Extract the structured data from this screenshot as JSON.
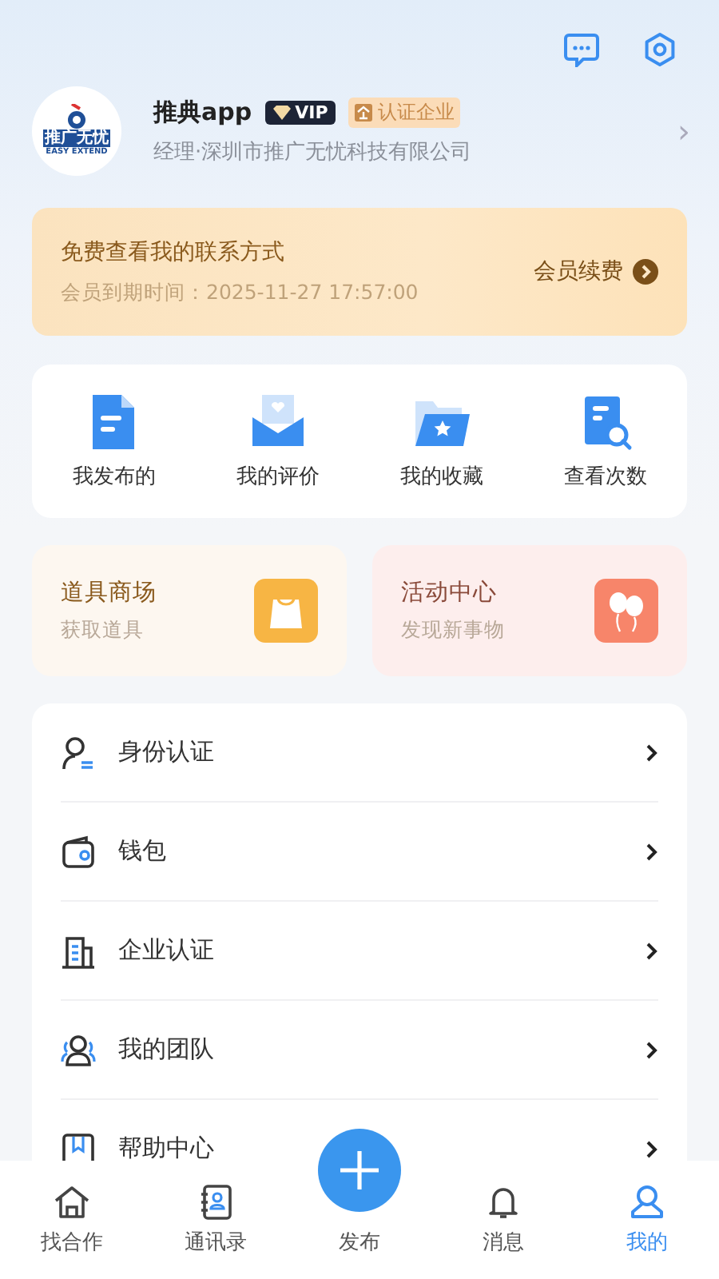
{
  "header": {
    "actions": [
      {
        "kind": "message"
      },
      {
        "kind": "settings"
      }
    ]
  },
  "profile": {
    "logo_text": "推广无忧",
    "logo_subtext": "EASY EXTEND",
    "name": "推典app",
    "vip_badge": "VIP",
    "cert_badge": "认证企业",
    "subtitle": "经理·深圳市推广无忧科技有限公司",
    "chevron": "›"
  },
  "membership": {
    "title": "免费查看我的联系方式",
    "expiry": "会员到期时间：2025-11-27 17:57:00",
    "action": "会员续费"
  },
  "shortcuts": [
    {
      "kind": "publish",
      "label": "我发布的"
    },
    {
      "kind": "review",
      "label": "我的评价"
    },
    {
      "kind": "favorite",
      "label": "我的收藏"
    },
    {
      "kind": "views",
      "label": "查看次数"
    }
  ],
  "promo_cards": [
    {
      "kind": "shop",
      "title": "道具商场",
      "subtitle": "获取道具"
    },
    {
      "kind": "events",
      "title": "活动中心",
      "subtitle": "发现新事物"
    }
  ],
  "menu": [
    {
      "kind": "identity",
      "label": "身份认证"
    },
    {
      "kind": "wallet",
      "label": "钱包"
    },
    {
      "kind": "company",
      "label": "企业认证"
    },
    {
      "kind": "team",
      "label": "我的团队"
    },
    {
      "kind": "help",
      "label": "帮助中心"
    }
  ],
  "tab_bar": [
    {
      "kind": "home",
      "label": "找合作",
      "selected": false
    },
    {
      "kind": "contacts",
      "label": "通讯录",
      "selected": false
    },
    {
      "kind": "publish",
      "label": "发布",
      "selected": false
    },
    {
      "kind": "bell",
      "label": "消息",
      "selected": false
    },
    {
      "kind": "user",
      "label": "我的",
      "selected": true
    }
  ]
}
